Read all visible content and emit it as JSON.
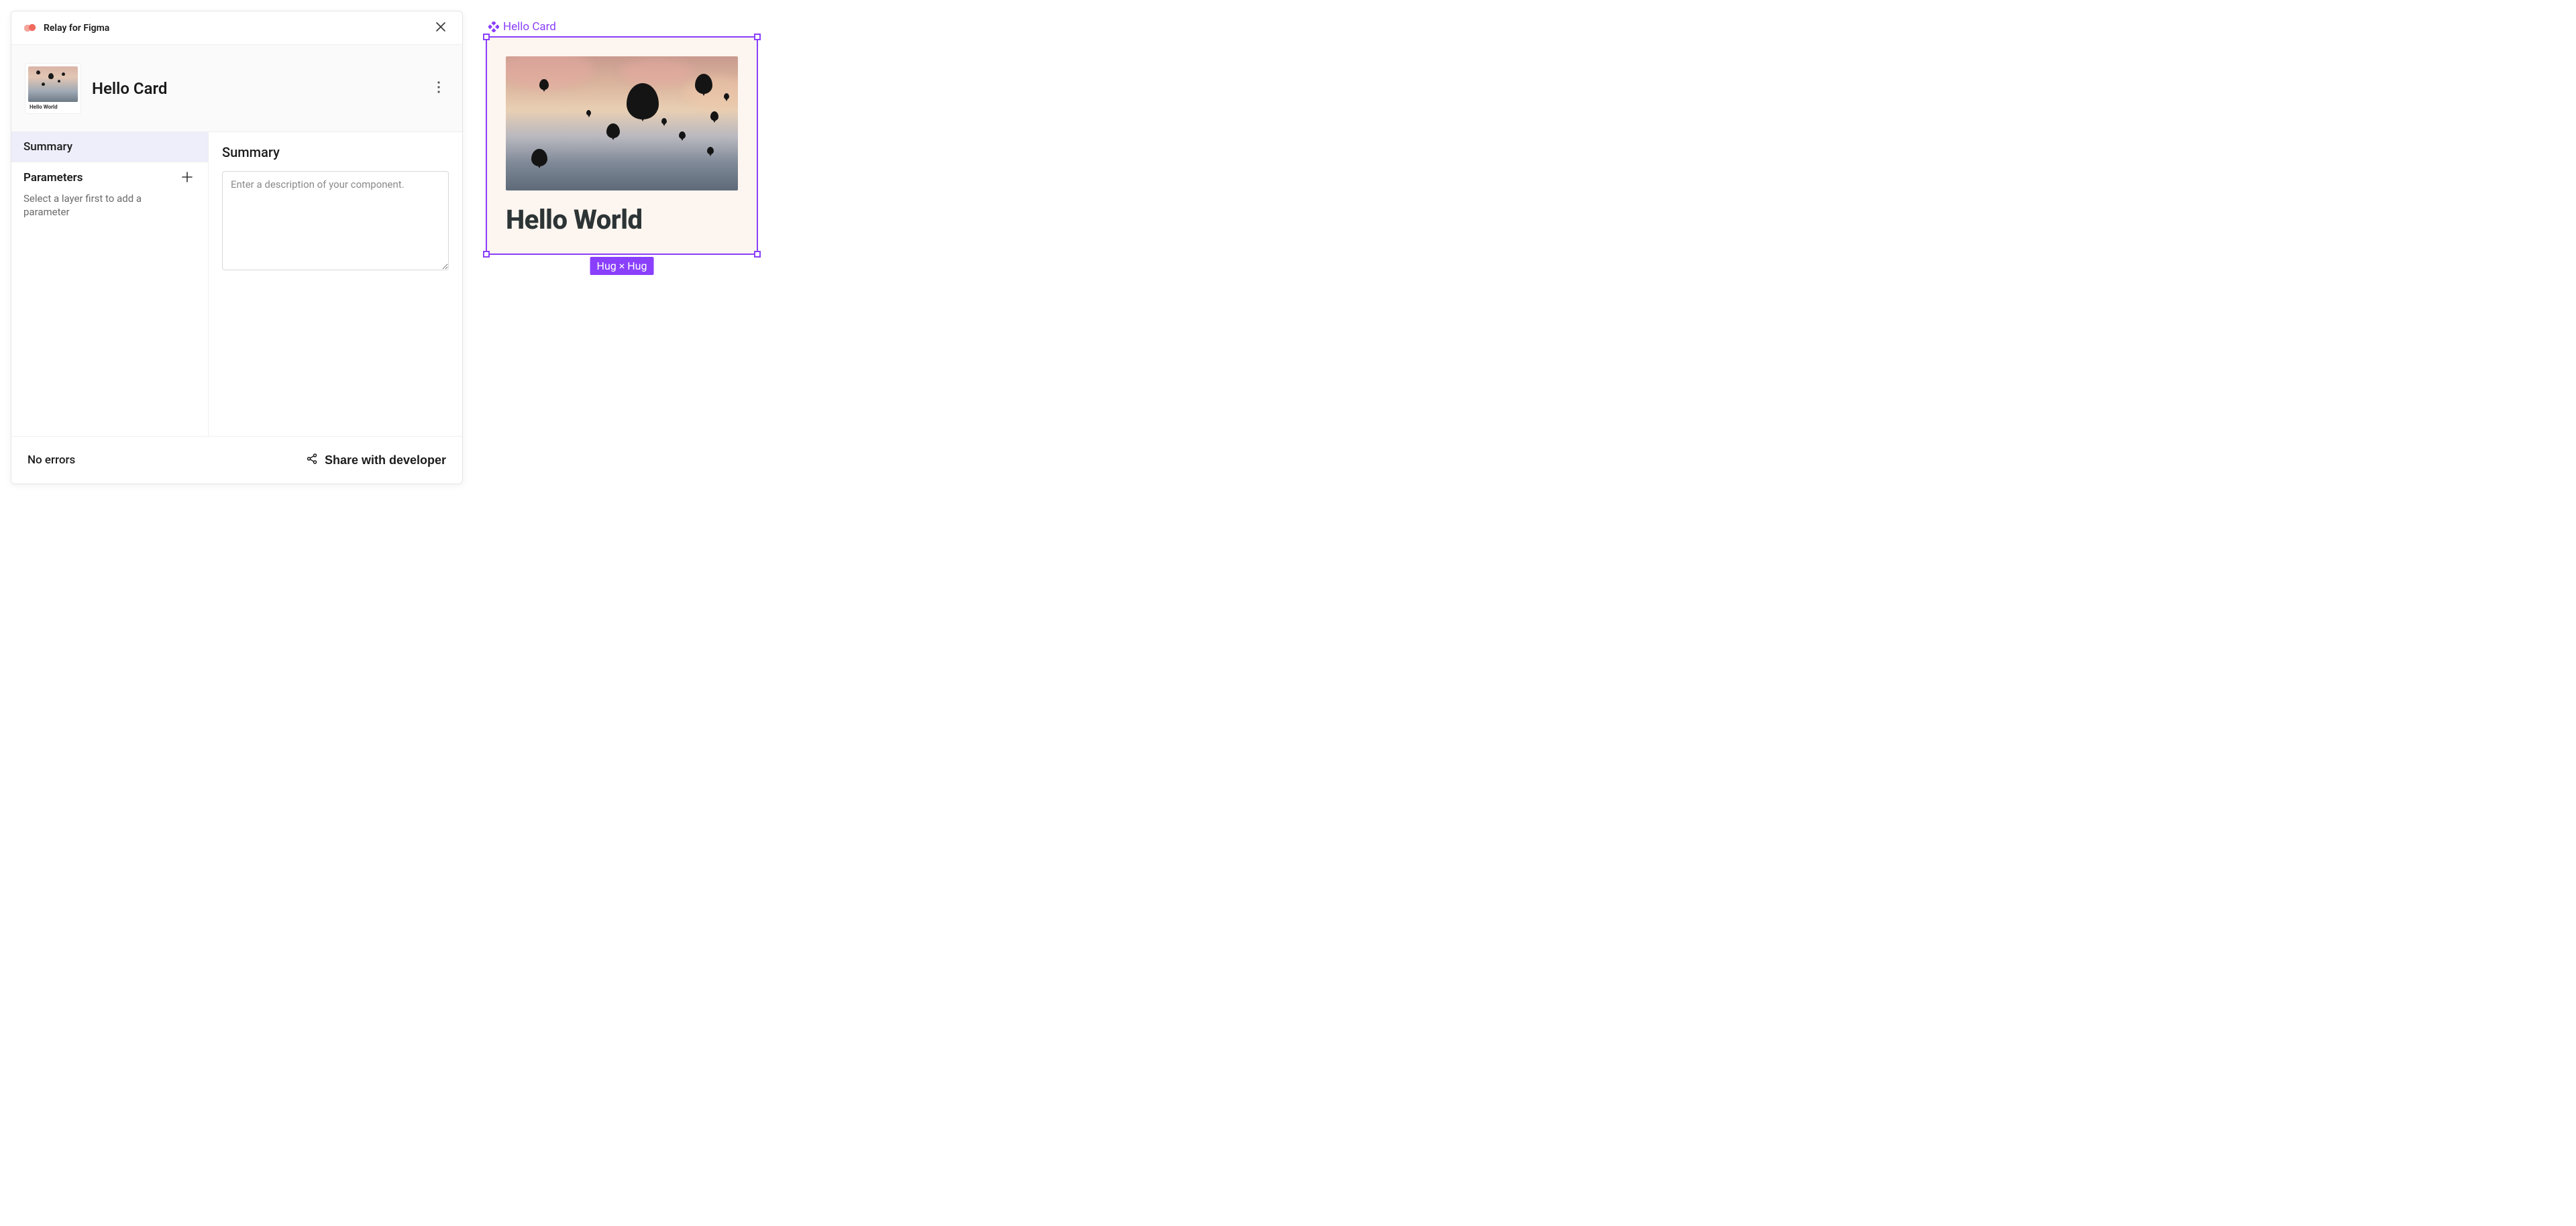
{
  "panel": {
    "titlebar": {
      "app_name": "Relay for Figma"
    },
    "component_header": {
      "thumbnail_caption": "Hello World",
      "title": "Hello Card"
    },
    "sidebar": {
      "tab_summary": "Summary",
      "parameters_title": "Parameters",
      "parameters_hint": "Select a layer first to add a parameter"
    },
    "main": {
      "title": "Summary",
      "description_placeholder": "Enter a description of your component."
    },
    "footer": {
      "status": "No errors",
      "share_label": "Share with developer"
    }
  },
  "canvas": {
    "component_label": "Hello Card",
    "card_text": "Hello World",
    "size_badge": "Hug × Hug"
  },
  "colors": {
    "figma_purple": "#8a3ffc",
    "relay_coral": "#f36b5f"
  }
}
